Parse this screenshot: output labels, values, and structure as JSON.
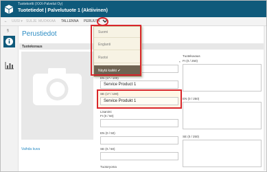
{
  "header": {
    "company": "Tuotekortti (XXX-Palvelut Oy)",
    "title": "Tuotetiedot | Palvelutuote 1 (Aktiivinen)"
  },
  "toolbar": {
    "back": "←",
    "actions": [
      "UUSI ▾",
      "SULJE",
      "MUOKKAA",
      "TALLENNA",
      "PERUUTA"
    ],
    "more_icon": "chevron-down-icon"
  },
  "nav": {
    "item_label": "§"
  },
  "main": {
    "section_title": "Perustiedot",
    "subheader": "Tuotekoraus",
    "change_image": "Vaihda kuva"
  },
  "dropdown": {
    "items": [
      "Suomi",
      "Englanti",
      "Ruotsi"
    ],
    "show_all": "Näytä kaikki ✔"
  },
  "form": {
    "name_required_marker": "*",
    "en_label": "EN (17 / 100)",
    "en_value": "Service Product 1",
    "se_label": "SE (17 / 100)",
    "se_value": "Service Produkt 1",
    "extra_label": "Lisanimi",
    "fi_label_50": "FI (0 / 50)",
    "en_label_50": "EN (0 / 50)",
    "se_label_50": "SE (0 / 50)",
    "sub_label": "Tuotoryoma",
    "desc_label": "Tuotekuvaus",
    "desc_fi": "FI (0 / 250)",
    "desc_en": "EN (0 / 250)",
    "desc_se": "SE (0 / 250)"
  },
  "colors": {
    "brand": "#0f5a7b",
    "link": "#2a8bc3",
    "highlight": "#d9262b"
  }
}
